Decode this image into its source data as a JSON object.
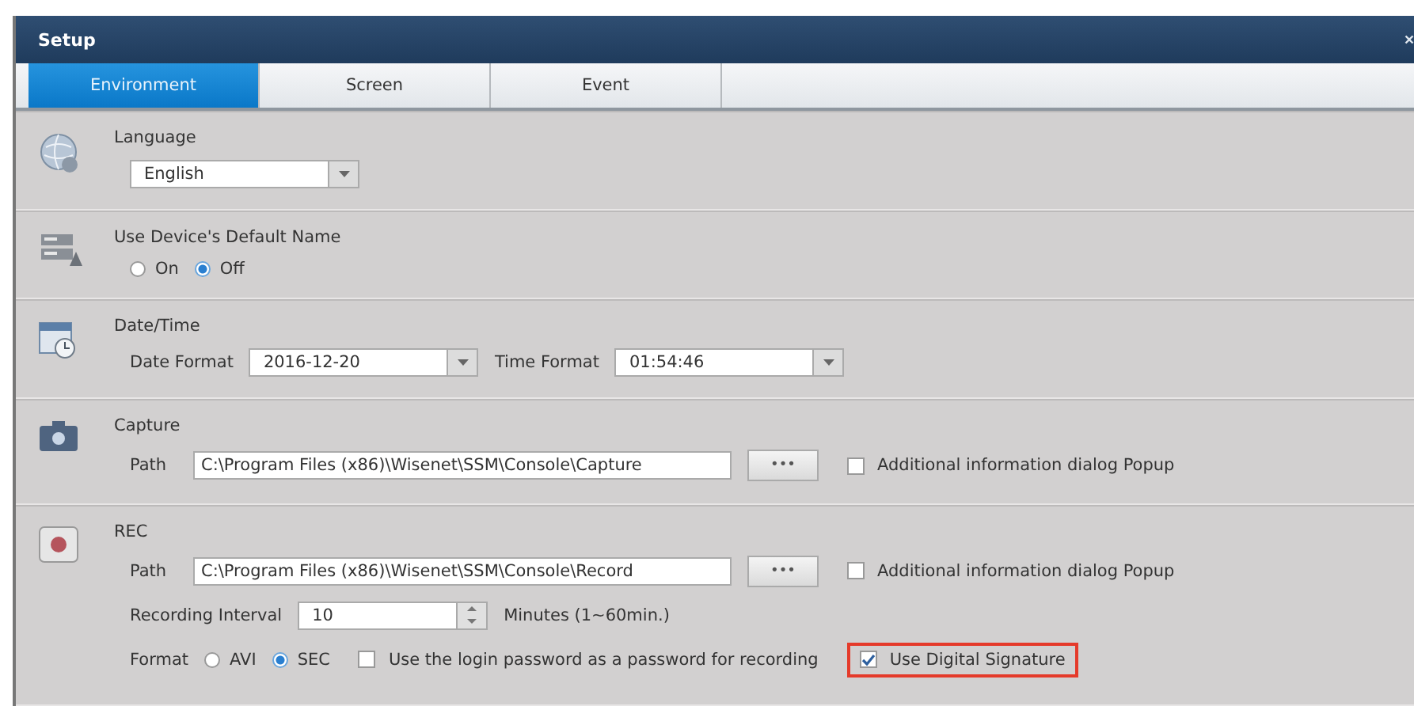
{
  "window": {
    "title": "Setup"
  },
  "tabs": [
    {
      "label": "Environment",
      "selected": true
    },
    {
      "label": "Screen",
      "selected": false
    },
    {
      "label": "Event",
      "selected": false
    }
  ],
  "sections": [
    {
      "title": "Language",
      "lines": [
        {
          "items": [
            {
              "kind": "select",
              "value": "English"
            }
          ]
        }
      ]
    },
    {
      "title": "Use Device's Default Name",
      "lines": [
        {
          "items": [
            {
              "kind": "radio",
              "label": "On",
              "selected": false
            },
            {
              "kind": "radio",
              "label": "Off",
              "selected": true
            }
          ]
        }
      ]
    },
    {
      "title": "Date/Time",
      "lines": [
        {
          "items": [
            {
              "kind": "label",
              "text": "Date Format"
            },
            {
              "kind": "select",
              "value": "2016-12-20"
            },
            {
              "kind": "label",
              "text": "Time Format"
            },
            {
              "kind": "select",
              "value": "01:54:46"
            }
          ]
        }
      ]
    },
    {
      "title": "Capture",
      "lines": [
        {
          "items": [
            {
              "kind": "label",
              "text": "Path"
            },
            {
              "kind": "path",
              "value": "C:\\Program Files (x86)\\Wisenet\\SSM\\Console\\Capture"
            },
            {
              "kind": "button",
              "label": "•••"
            },
            {
              "kind": "checkbox",
              "label": "Additional information dialog Popup",
              "checked": false
            }
          ]
        }
      ]
    },
    {
      "title": "REC",
      "lines": [
        {
          "items": [
            {
              "kind": "label",
              "text": "Path"
            },
            {
              "kind": "path",
              "value": "C:\\Program Files (x86)\\Wisenet\\SSM\\Console\\Record"
            },
            {
              "kind": "button",
              "label": "•••"
            },
            {
              "kind": "checkbox",
              "label": "Additional information dialog Popup",
              "checked": false
            }
          ]
        },
        {
          "items": [
            {
              "kind": "label",
              "text": "Recording Interval"
            },
            {
              "kind": "spinner",
              "value": "10"
            },
            {
              "kind": "label",
              "text": "Minutes (1~60min.)"
            }
          ]
        },
        {
          "items": [
            {
              "kind": "label",
              "text": "Format"
            },
            {
              "kind": "radio",
              "label": "AVI",
              "selected": false
            },
            {
              "kind": "radio",
              "label": "SEC",
              "selected": true
            },
            {
              "kind": "checkbox",
              "label": "Use the login password as a password for recording",
              "checked": false
            },
            {
              "kind": "checkbox",
              "label": "Use Digital Signature",
              "checked": true,
              "highlighted": true
            }
          ]
        }
      ]
    }
  ]
}
